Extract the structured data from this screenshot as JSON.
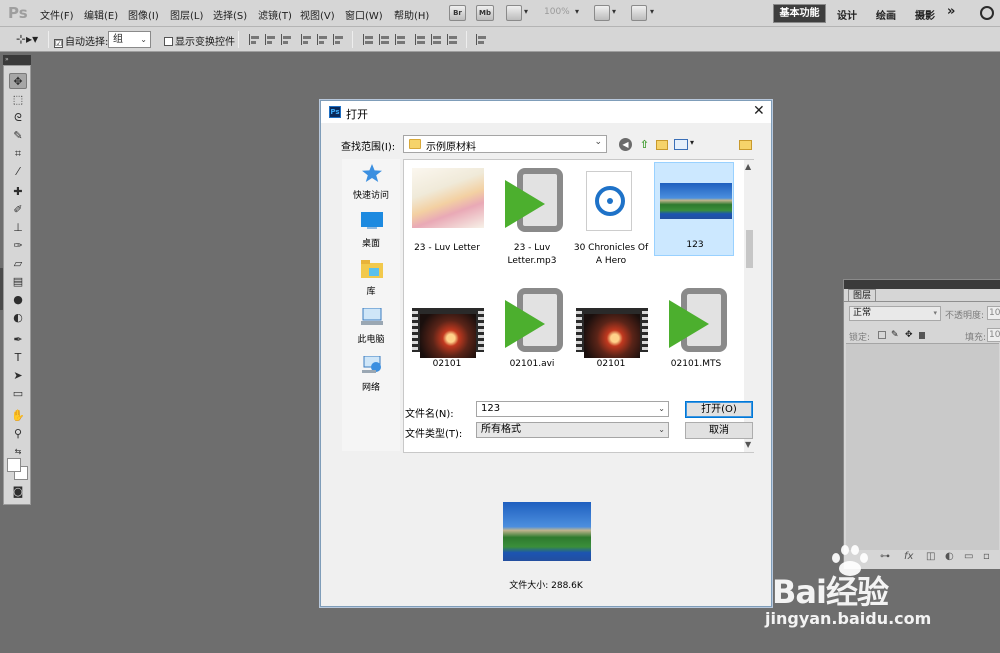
{
  "app": {
    "logo": "Ps",
    "menu": [
      "文件(F)",
      "编辑(E)",
      "图像(I)",
      "图层(L)",
      "选择(S)",
      "滤镜(T)",
      "视图(V)",
      "窗口(W)",
      "帮助(H)"
    ],
    "bridge_label": "Br",
    "minibridge_label": "Mb",
    "zoom": "100%",
    "workspaces": {
      "active": "基本功能",
      "design": "设计",
      "painting": "绘画",
      "photography": "摄影",
      "more": "»"
    }
  },
  "options": {
    "auto_select_label": "自动选择:",
    "auto_select_checked": "☑",
    "auto_select_value": "组",
    "show_transform_label": "显示变换控件"
  },
  "layers_panel": {
    "tab": "图层",
    "blend_mode": "正常",
    "opacity_label": "不透明度:",
    "opacity_value": "10",
    "lock_label": "锁定:",
    "fill_label": "填充:",
    "fill_value": "10"
  },
  "dialog": {
    "title": "打开",
    "title_icon": "Ps",
    "close": "✕",
    "look_in_label": "查找范围(I):",
    "look_in_value": "示例原材料",
    "places": [
      {
        "label": "快速访问",
        "icon": "star-icon"
      },
      {
        "label": "桌面",
        "icon": "desktop-icon"
      },
      {
        "label": "库",
        "icon": "library-icon"
      },
      {
        "label": "此电脑",
        "icon": "computer-icon"
      },
      {
        "label": "网络",
        "icon": "network-icon"
      }
    ],
    "files": [
      {
        "name": "23 - Luv Letter",
        "type": "image"
      },
      {
        "name": "23 - Luv Letter.mp3",
        "type": "media"
      },
      {
        "name": "30 Chronicles Of A Hero",
        "type": "audio"
      },
      {
        "name": "123",
        "type": "image",
        "selected": true
      },
      {
        "name": "02101",
        "type": "video"
      },
      {
        "name": "02101.avi",
        "type": "media"
      },
      {
        "name": "02101",
        "type": "video"
      },
      {
        "name": "02101.MTS",
        "type": "media"
      }
    ],
    "filename_label": "文件名(N):",
    "filename_value": "123",
    "filetype_label": "文件类型(T):",
    "filetype_value": "所有格式",
    "open_button": "打开(O)",
    "cancel_button": "取消",
    "file_size": "文件大小: 288.6K"
  },
  "watermark": {
    "brand": "Bai经验",
    "url": "jingyan.baidu.com"
  }
}
